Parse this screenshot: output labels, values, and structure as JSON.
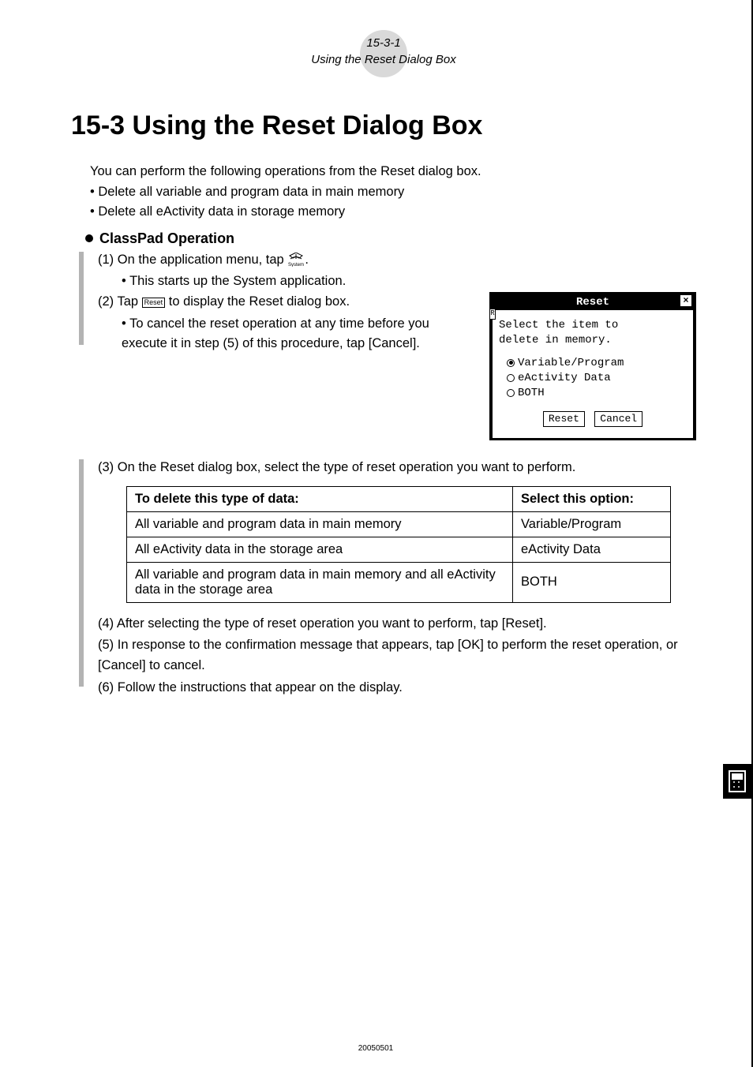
{
  "header": {
    "page_ref": "15-3-1",
    "running_title": "Using the Reset Dialog Box"
  },
  "title": "15-3  Using the Reset Dialog Box",
  "intro": {
    "line": "You can perform the following operations from the Reset dialog box.",
    "bullets": [
      "Delete all variable and program data in main memory",
      "Delete all eActivity data in storage memory"
    ]
  },
  "operation_heading": "ClassPad Operation",
  "steps": {
    "s1": {
      "text_before_icon": "(1) On the application menu, tap ",
      "text_after_icon": ".",
      "sub": "This starts up the System application."
    },
    "s2": {
      "text_before_icon": "(2) Tap ",
      "reset_icon_label": "Reset",
      "text_after_icon": " to display the Reset dialog box.",
      "sub": "To cancel the reset operation at any time before you execute it in step (5) of this procedure, tap [Cancel]."
    },
    "s3": "(3) On the Reset dialog box, select the type of reset operation you want to perform.",
    "s4": "(4) After selecting the type of reset operation you want to perform, tap [Reset].",
    "s5": "(5) In response to the confirmation message that appears, tap [OK] to perform the reset operation, or [Cancel] to cancel.",
    "s6": "(6) Follow the instructions that appear on the display."
  },
  "dialog": {
    "title": "Reset",
    "close_glyph": "×",
    "left_tab": "R",
    "prompt_l1": "Select the item to",
    "prompt_l2": "delete in memory.",
    "options": [
      {
        "label": "Variable/Program",
        "selected": true
      },
      {
        "label": "eActivity Data",
        "selected": false
      },
      {
        "label": "BOTH",
        "selected": false
      }
    ],
    "buttons": {
      "reset": "Reset",
      "cancel": "Cancel"
    }
  },
  "table": {
    "head": {
      "c1": "To delete this type of data:",
      "c2": "Select this option:"
    },
    "rows": [
      {
        "c1": "All variable and program data in main memory",
        "c2": "Variable/Program"
      },
      {
        "c1": "All eActivity data in the storage area",
        "c2": "eActivity Data"
      },
      {
        "c1": "All variable and program data in main memory and all eActivity data in the storage area",
        "c2": "BOTH"
      }
    ]
  },
  "footer_code": "20050501"
}
